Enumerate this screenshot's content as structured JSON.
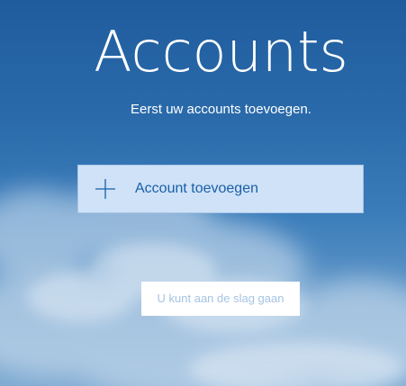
{
  "page": {
    "title": "Accounts",
    "subtitle": "Eerst uw accounts toevoegen."
  },
  "add_account": {
    "label": "Account toevoegen",
    "icon": "plus-icon"
  },
  "get_started": {
    "label": "U kunt aan de slag gaan",
    "state": "disabled"
  },
  "colors": {
    "sky_top": "#1f5c9e",
    "sky_bottom": "#7aa7d0",
    "add_button_bg": "#cfe2f7",
    "add_button_text": "#1a5fa8",
    "disabled_text": "#a4c4e3"
  }
}
